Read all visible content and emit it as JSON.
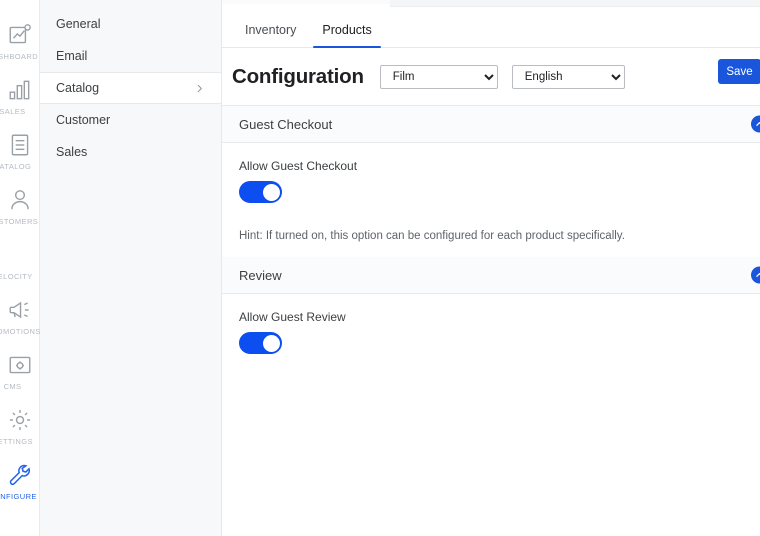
{
  "rail": {
    "items": [
      {
        "label": "DASHBOARD",
        "icon": "dashboard-chart-icon",
        "active": false
      },
      {
        "label": "SALES",
        "icon": "bar-chart-icon",
        "active": false
      },
      {
        "label": "CATALOG",
        "icon": "document-list-icon",
        "active": false
      },
      {
        "label": "CUSTOMERS",
        "icon": "user-icon",
        "active": false
      },
      {
        "label": "VELOCITY",
        "icon": "velocity-icon",
        "active": false
      },
      {
        "label": "PROMOTIONS",
        "icon": "megaphone-icon",
        "active": false
      },
      {
        "label": "CMS",
        "icon": "image-gear-icon",
        "active": false
      },
      {
        "label": "SETTINGS",
        "icon": "gear-icon",
        "active": false
      },
      {
        "label": "CONFIGURE",
        "icon": "wrench-icon",
        "active": true
      }
    ],
    "active_color": "#2563eb",
    "inactive_color": "#b6bbc1"
  },
  "subnav": {
    "items": [
      {
        "label": "General",
        "active": false,
        "has_chevron": false
      },
      {
        "label": "Email",
        "active": false,
        "has_chevron": false
      },
      {
        "label": "Catalog",
        "active": true,
        "has_chevron": true
      },
      {
        "label": "Customer",
        "active": false,
        "has_chevron": false
      },
      {
        "label": "Sales",
        "active": false,
        "has_chevron": false
      }
    ]
  },
  "tabs": [
    {
      "label": "Inventory",
      "active": false
    },
    {
      "label": "Products",
      "active": true
    }
  ],
  "header": {
    "title": "Configuration",
    "scope_select": {
      "value": "Film",
      "options": [
        "Film"
      ]
    },
    "language_select": {
      "value": "English",
      "options": [
        "English"
      ]
    },
    "save_label": "Save",
    "save_color": "#1a56db"
  },
  "sections": [
    {
      "title": "Guest Checkout",
      "collapse_icon": "chevron-up-icon",
      "field_label": "Allow Guest Checkout",
      "toggle_on": true,
      "hint": "Hint: If turned on, this option can be configured for each product specifically."
    },
    {
      "title": "Review",
      "collapse_icon": "chevron-up-icon",
      "field_label": "Allow Guest Review",
      "toggle_on": true,
      "hint": ""
    }
  ],
  "theme": {
    "accent": "#1a56db",
    "toggle_on_color": "#0c4ef0",
    "sidebar_bg": "#f7f8fa",
    "section_head_bg": "#fafbfc"
  }
}
